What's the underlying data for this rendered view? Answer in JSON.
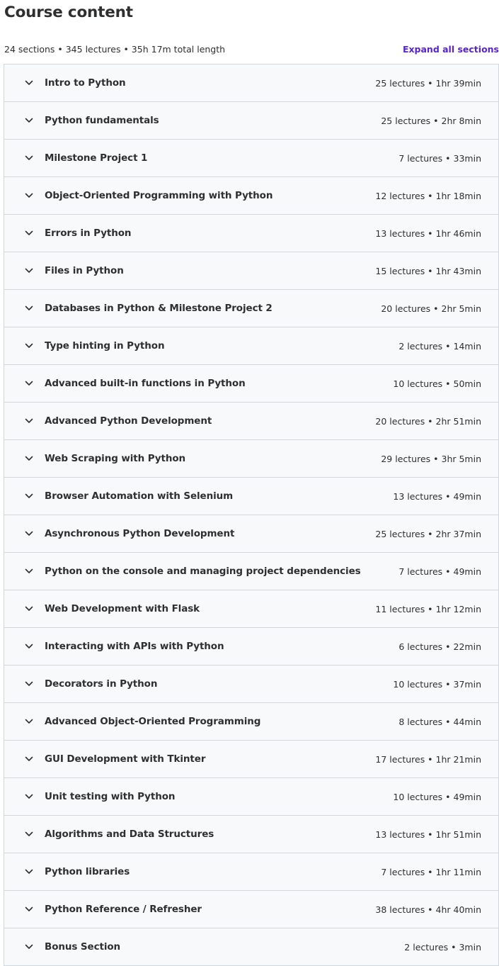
{
  "header": {
    "title": "Course content",
    "summary": "24 sections • 345 lectures • 35h 17m total length",
    "expand_label": "Expand all sections"
  },
  "colors": {
    "accent": "#5624d0",
    "text": "#2d2f31",
    "row_bg": "#f7f9fa",
    "border": "#d1d7dc"
  },
  "sections": [
    {
      "title": "Intro to Python",
      "meta": "25 lectures • 1hr 39min",
      "icon": "chevron-down-icon"
    },
    {
      "title": "Python fundamentals",
      "meta": "25 lectures • 2hr 8min",
      "icon": "chevron-down-icon"
    },
    {
      "title": "Milestone Project 1",
      "meta": "7 lectures • 33min",
      "icon": "chevron-down-icon"
    },
    {
      "title": "Object-Oriented Programming with Python",
      "meta": "12 lectures • 1hr 18min",
      "icon": "chevron-down-icon"
    },
    {
      "title": "Errors in Python",
      "meta": "13 lectures • 1hr 46min",
      "icon": "chevron-down-icon"
    },
    {
      "title": "Files in Python",
      "meta": "15 lectures • 1hr 43min",
      "icon": "chevron-down-icon"
    },
    {
      "title": "Databases in Python & Milestone Project 2",
      "meta": "20 lectures • 2hr 5min",
      "icon": "chevron-down-icon"
    },
    {
      "title": "Type hinting in Python",
      "meta": "2 lectures • 14min",
      "icon": "chevron-down-icon"
    },
    {
      "title": "Advanced built-in functions in Python",
      "meta": "10 lectures • 50min",
      "icon": "chevron-down-icon"
    },
    {
      "title": "Advanced Python Development",
      "meta": "20 lectures • 2hr 51min",
      "icon": "chevron-down-icon"
    },
    {
      "title": "Web Scraping with Python",
      "meta": "29 lectures • 3hr 5min",
      "icon": "chevron-down-icon"
    },
    {
      "title": "Browser Automation with Selenium",
      "meta": "13 lectures • 49min",
      "icon": "chevron-down-icon"
    },
    {
      "title": "Asynchronous Python Development",
      "meta": "25 lectures • 2hr 37min",
      "icon": "chevron-down-icon"
    },
    {
      "title": "Python on the console and managing project dependencies",
      "meta": "7 lectures • 49min",
      "icon": "chevron-down-icon"
    },
    {
      "title": "Web Development with Flask",
      "meta": "11 lectures • 1hr 12min",
      "icon": "chevron-down-icon"
    },
    {
      "title": "Interacting with APIs with Python",
      "meta": "6 lectures • 22min",
      "icon": "chevron-down-icon"
    },
    {
      "title": "Decorators in Python",
      "meta": "10 lectures • 37min",
      "icon": "chevron-down-icon"
    },
    {
      "title": "Advanced Object-Oriented Programming",
      "meta": "8 lectures • 44min",
      "icon": "chevron-down-icon"
    },
    {
      "title": "GUI Development with Tkinter",
      "meta": "17 lectures • 1hr 21min",
      "icon": "chevron-down-icon"
    },
    {
      "title": "Unit testing with Python",
      "meta": "10 lectures • 49min",
      "icon": "chevron-down-icon"
    },
    {
      "title": "Algorithms and Data Structures",
      "meta": "13 lectures • 1hr 51min",
      "icon": "chevron-down-icon"
    },
    {
      "title": "Python libraries",
      "meta": "7 lectures • 1hr 11min",
      "icon": "chevron-down-icon"
    },
    {
      "title": "Python Reference / Refresher",
      "meta": "38 lectures • 4hr 40min",
      "icon": "chevron-down-icon"
    },
    {
      "title": "Bonus Section",
      "meta": "2 lectures • 3min",
      "icon": "chevron-down-icon"
    }
  ]
}
